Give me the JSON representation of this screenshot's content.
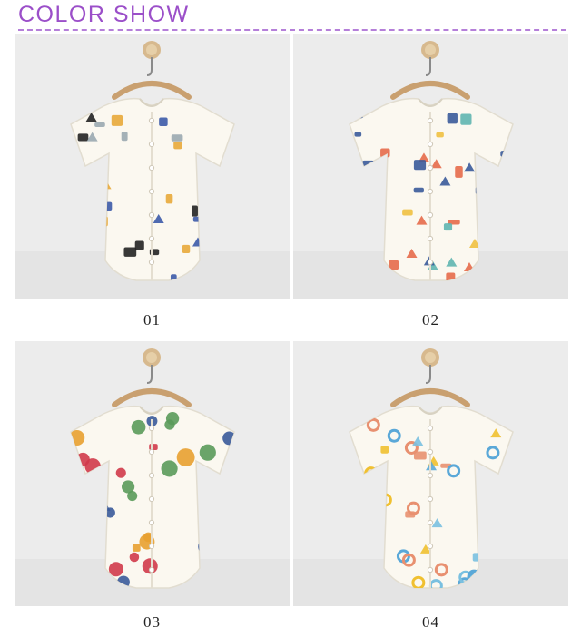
{
  "header": {
    "title": "COLOR SHOW"
  },
  "products": [
    {
      "label": "01",
      "icon": "dinosaur-print-romper-image",
      "print_colors": [
        "#3c5aa8",
        "#e8a83a",
        "#9aa8b0",
        "#222222"
      ]
    },
    {
      "label": "02",
      "icon": "forest-print-romper-image",
      "print_colors": [
        "#e56a4a",
        "#5fb5b0",
        "#3a5a9a",
        "#f0c040"
      ]
    },
    {
      "label": "03",
      "icon": "fruit-print-romper-image",
      "print_colors": [
        "#e8a030",
        "#d03a4a",
        "#5a9a5a",
        "#3a5a9a"
      ]
    },
    {
      "label": "04",
      "icon": "letter-print-romper-image",
      "print_colors": [
        "#f0c030",
        "#5aa8d8",
        "#e89070",
        "#7ac0e0"
      ]
    }
  ]
}
